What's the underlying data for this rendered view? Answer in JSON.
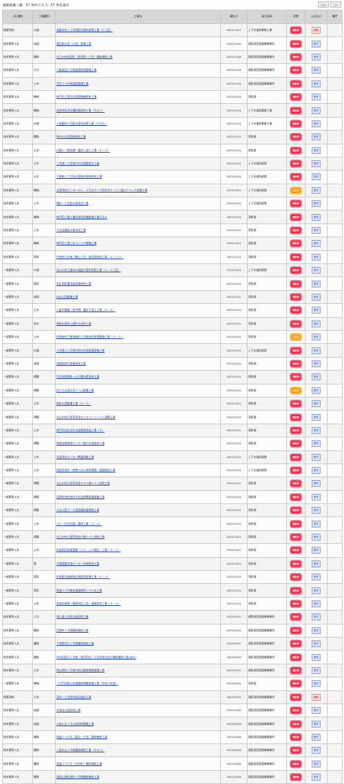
{
  "page_title": "検索結果一覧：57 件のうち 1 - 57 件を表示",
  "buttons": {
    "print": "印刷",
    "close": "出力"
  },
  "headers": [
    "入札種別",
    "工事種別",
    "工事名",
    "開札日",
    "発注部局",
    "状態",
    "入札区分",
    "備考"
  ],
  "rows": [
    {
      "type": "随意契約",
      "kind": "水道",
      "name": "長野本町三丁目他配水管布設替工事（２工区）",
      "date": "2022/11/07",
      "dept": "上下水道局事務工事",
      "status": "red",
      "status_text": "契約済",
      "badge": "red",
      "badge_text": "随契"
    },
    {
      "type": "指名競争入札",
      "kind": "造園",
      "name": "富田緑公園（公園）整備工事",
      "date": "2022/11/04",
      "dept": "建設局西部整備事務所",
      "status": "red",
      "status_text": "契約済",
      "badge": "blue",
      "badge_text": "電子"
    },
    {
      "type": "指名競争入札",
      "kind": "舗装",
      "name": "北九州市若園町（奥洞第一丁目）舗装補修工事",
      "date": "2022/11/04",
      "dept": "建設局西部整備事務所",
      "status": "red",
      "status_text": "契約済",
      "badge": "blue",
      "badge_text": "電子"
    },
    {
      "type": "指名競争入札",
      "kind": "とび",
      "name": "小敷造園２号線道路照明整備工事",
      "date": "2022/11/04",
      "dept": "建設局西部整備事務所",
      "status": "red",
      "status_text": "契約済",
      "badge": "blue",
      "badge_text": "電子"
    },
    {
      "type": "指名競争入札",
      "kind": "土木",
      "name": "浅生２５号線道路整備工事",
      "date": "2022/11/04",
      "dept": "建設局西部整備事務所",
      "status": "red",
      "status_text": "契約済",
      "badge": "blue",
      "badge_text": "電子"
    },
    {
      "type": "指名競争入札",
      "kind": "機械",
      "name": "新門司工場冷却塔電動機更新工事",
      "date": "2022/11/01",
      "dept": "契約部",
      "status": "red",
      "status_text": "契約済",
      "badge": "blue",
      "badge_text": "電子"
    },
    {
      "type": "指名競争入札",
      "kind": "機械",
      "name": "東部地区浄化槽設備改修工事（その１）",
      "date": "2022/11/01",
      "dept": "上下水道局事務工事",
      "status": "red",
      "status_text": "契約済",
      "badge": "blue",
      "badge_text": "電子"
    },
    {
      "type": "指名競争入札",
      "kind": "水道",
      "name": "上屋敷四丁目配水管布設替工事（その２）",
      "date": "2022/11/01",
      "dept": "上下水道局事務工事",
      "status": "red",
      "status_text": "契約済",
      "badge": "blue",
      "badge_text": "電子"
    },
    {
      "type": "指名競争入札",
      "kind": "舗装",
      "name": "和布刈公園園路改修工事",
      "date": "2022/11/01",
      "dept": "契約部",
      "status": "red",
      "status_text": "契約済",
      "badge": "blue",
      "badge_text": "電子"
    },
    {
      "type": "指名競争入札",
      "kind": "土木",
      "name": "白尾川（黒田橋）護岸上部工工事（４－２）",
      "date": "2022/11/01",
      "dept": "契約部",
      "status": "red",
      "status_text": "契約済",
      "badge": "blue",
      "badge_text": "電子"
    },
    {
      "type": "指名競争入札",
      "kind": "土木",
      "name": "上到津一丁目地内汚水管渠更生工事",
      "date": "2022/11/01",
      "dept": "上下水道局経理",
      "status": "red",
      "status_text": "契約済",
      "badge": "blue",
      "badge_text": "電子"
    },
    {
      "type": "指名競争入札",
      "kind": "土木",
      "name": "下曽根二丁目雨水管渠布設替改修工事",
      "date": "2022/11/01",
      "dept": "上下水道局経理",
      "status": "red",
      "status_text": "契約済",
      "badge": "blue",
      "badge_text": "電子"
    },
    {
      "type": "指名競争入札",
      "kind": "機械",
      "name": "北湊浄化センターＮｏ．４汚水ポンプ用空冷エンジン湿心クラッチ修繕工事",
      "date": "2022/11/01",
      "dept": "上下水道局経理",
      "status": "orange",
      "status_text": "入札中",
      "badge": "blue",
      "badge_text": "電子"
    },
    {
      "type": "指名競争入札",
      "kind": "土木",
      "name": "響町一丁目配水管改良工事",
      "date": "2022/11/01",
      "dept": "上下水道局経理",
      "status": "red",
      "status_text": "契約済",
      "badge": "blue",
      "badge_text": "電子"
    },
    {
      "type": "指名競争入札",
      "kind": "機械",
      "name": "新門司工場５番式焼却設備整備工事その２",
      "date": "2022/11/01",
      "dept": "契約部",
      "status": "red",
      "status_text": "契約済",
      "badge": "blue",
      "badge_text": "電子"
    },
    {
      "type": "指名競争入札",
      "kind": "土木",
      "name": "大学会館配水管布設工事",
      "date": "2022/11/01",
      "dept": "契約部",
      "status": "red",
      "status_text": "契約済",
      "badge": "blue",
      "badge_text": "電子"
    },
    {
      "type": "指名競争入札",
      "kind": "機械",
      "name": "新門司工場ごみコンベヤ整備工事",
      "date": "2022/11/01",
      "dept": "契約部",
      "status": "red",
      "status_text": "契約済",
      "badge": "blue",
      "badge_text": "電子"
    },
    {
      "type": "指名競争入札",
      "kind": "電気",
      "name": "中央町六右線（豊山工区）道号照明設工事（４－１０）",
      "date": "2022/11/01",
      "dept": "契約部",
      "status": "red",
      "status_text": "契約済",
      "badge": "blue",
      "badge_text": "電子"
    },
    {
      "type": "一般競争入札",
      "kind": "水道",
      "name": "北九州市工業用水道配水管布設替工事（４－５工区）",
      "date": "2022/11/01",
      "dept": "上下水道局経理",
      "status": "red",
      "status_text": "契約済",
      "badge": "blue",
      "badge_text": "電子"
    },
    {
      "type": "一般競争入札",
      "kind": "電気",
      "name": "若松消防署改造設備改修工事",
      "date": "2022/11/01",
      "dept": "契約部",
      "status": "red",
      "status_text": "契約済",
      "badge": "blue",
      "badge_text": "電子"
    },
    {
      "type": "一般競争入札",
      "kind": "造園",
      "name": "仙水公園整備工事",
      "date": "2022/11/01",
      "dept": "契約部",
      "status": "red",
      "status_text": "契約済",
      "badge": "blue",
      "badge_text": "電子"
    },
    {
      "type": "一般競争入札",
      "kind": "土木",
      "name": "小倉中間線（徳代橋）護岸下部工工事（４－１）",
      "date": "2022/11/01",
      "dept": "契約部",
      "status": "red",
      "status_text": "契約済",
      "badge": "blue",
      "badge_text": "電子"
    },
    {
      "type": "一般競争入札",
      "kind": "防水",
      "name": "曽根出張所上層防水改修工事",
      "date": "2022/11/01",
      "dept": "契約部",
      "status": "red",
      "status_text": "契約済",
      "badge": "blue",
      "badge_text": "電子"
    },
    {
      "type": "一般競争入札",
      "kind": "土木",
      "name": "田原新町下曽根新町１号線自転車通整備工事（４－２）",
      "date": "2022/11/01",
      "dept": "契約部",
      "status": "orange",
      "status_text": "入札中",
      "badge": "blue",
      "badge_text": "電子"
    },
    {
      "type": "一般競争入札",
      "kind": "水道",
      "name": "上到津二丁目地内雨水合流管渠整備工事",
      "date": "2022/11/01",
      "dept": "上下水道局経理",
      "status": "red",
      "status_text": "契約済",
      "badge": "blue",
      "badge_text": "電子"
    },
    {
      "type": "一般競争入札",
      "kind": "塗装",
      "name": "道路照明灯整備塗装工事",
      "date": "2022/11/01",
      "dept": "契約部",
      "status": "red",
      "status_text": "契約済",
      "badge": "blue",
      "badge_text": "電子"
    },
    {
      "type": "一般競争入札",
      "kind": "建築",
      "name": "門司消防署和ー丈分署外壁改修工事",
      "date": "2022/11/01",
      "dept": "契約部",
      "status": "red",
      "status_text": "契約済",
      "badge": "blue",
      "badge_text": "電子"
    },
    {
      "type": "一般競争入札",
      "kind": "建築",
      "name": "松ケ江公園天空ドーム整備工事",
      "date": "2022/11/01",
      "dept": "契約部",
      "status": "orange",
      "status_text": "入札中",
      "badge": "blue",
      "badge_text": "電子"
    },
    {
      "type": "一般競争入札",
      "kind": "土木",
      "name": "新町公園整備工事（４－１）",
      "date": "2022/11/01",
      "dept": "契約部",
      "status": "red",
      "status_text": "契約済",
      "badge": "blue",
      "badge_text": "電子"
    },
    {
      "type": "一般競争入札",
      "kind": "建築",
      "name": "北九州市立高等学校テニスコートトイレ改築工事",
      "date": "2022/11/01",
      "dept": "契約部",
      "status": "red",
      "status_text": "契約済",
      "badge": "blue",
      "badge_text": "電子"
    },
    {
      "type": "一般競争入札",
      "kind": "土木",
      "name": "新門司北住宅北水道管路改造工事（４）",
      "date": "2022/11/01",
      "dept": "契約部",
      "status": "red",
      "status_text": "契約済",
      "badge": "blue",
      "badge_text": "電子"
    },
    {
      "type": "一般競争入札",
      "kind": "建築",
      "name": "情報技術教育センター露の空調改修工事",
      "date": "2022/11/01",
      "dept": "契約部",
      "status": "red",
      "status_text": "契約済",
      "badge": "blue",
      "badge_text": "電子"
    },
    {
      "type": "一般競争入札",
      "kind": "土木",
      "name": "北湊浄化センター覆蓋改築工事",
      "date": "2022/11/01",
      "dept": "上下水道局経理",
      "status": "red",
      "status_text": "契約済",
      "badge": "blue",
      "badge_text": "電子"
    },
    {
      "type": "一般競争入札",
      "kind": "土木",
      "name": "相見町地内（南勲川河川改修関連）管渠移設工事",
      "date": "2022/11/01",
      "dept": "上下水道局経理",
      "status": "red",
      "status_text": "契約済",
      "badge": "blue",
      "badge_text": "電子"
    },
    {
      "type": "一般競争入札",
      "kind": "建築",
      "name": "北九州市立高等学校ＲＧＨ棟トイレ改修工事",
      "date": "2022/11/01",
      "dept": "契約部",
      "status": "red",
      "status_text": "契約済",
      "badge": "blue",
      "badge_text": "電子"
    },
    {
      "type": "一般競争入札",
      "kind": "建築",
      "name": "葛原町地内他雨水合流改築管渠整備工事",
      "date": "2022/11/01",
      "dept": "契約部",
      "status": "red",
      "status_text": "契約済",
      "badge": "blue",
      "badge_text": "電子"
    },
    {
      "type": "一般競争入札",
      "kind": "建築",
      "name": "大谷公園プール管理棟耐震補強工事",
      "date": "2022/11/01",
      "dept": "契約部",
      "status": "red",
      "status_text": "契約済",
      "badge": "blue",
      "badge_text": "電子"
    },
    {
      "type": "一般競争入札",
      "kind": "土木",
      "name": "江川（住宅区間）護岸工事（４－４）",
      "date": "2022/11/01",
      "dept": "契約部",
      "status": "red",
      "status_text": "契約済",
      "badge": "blue",
      "badge_text": "電子"
    },
    {
      "type": "一般競争入札",
      "kind": "建築",
      "name": "北九州市立高等学校Ｄ棟トイレ改修工事",
      "date": "2022/11/01",
      "dept": "契約部",
      "status": "red",
      "status_text": "契約済",
      "badge": "blue",
      "badge_text": "電子"
    },
    {
      "type": "一般競争入札",
      "kind": "土木",
      "name": "折尾地区街路整備（２３，２４前区）工事（４－３）",
      "date": "2022/11/01",
      "dept": "契約部",
      "status": "red",
      "status_text": "契約済",
      "badge": "blue",
      "badge_text": "電子"
    },
    {
      "type": "一般競争入札",
      "kind": "管",
      "name": "水環境館交流センター空調改修工事",
      "date": "2022/11/01",
      "dept": "契約部",
      "status": "red",
      "status_text": "契約済",
      "badge": "blue",
      "badge_text": "電子"
    },
    {
      "type": "一般競争入札",
      "kind": "電気",
      "name": "折尾駅北側駅前広場照明設備工事（４－２）",
      "date": "2022/11/01",
      "dept": "契約部",
      "status": "red",
      "status_text": "契約済",
      "badge": "blue",
      "badge_text": "電子"
    },
    {
      "type": "一般競争入札",
      "kind": "電気",
      "name": "国道４６号線他道路照明ＬＥＤ化工事",
      "date": "2022/11/01",
      "dept": "契約部",
      "status": "red",
      "status_text": "契約済",
      "badge": "blue",
      "badge_text": "電子"
    },
    {
      "type": "一般競争入札",
      "kind": "土木",
      "name": "尾倉町線線（東尾街区工区）道路改良工事（４－３）",
      "date": "2022/11/01",
      "dept": "契約部",
      "status": "red",
      "status_text": "契約済",
      "badge": "blue",
      "badge_text": "電子"
    },
    {
      "type": "指名競争入札",
      "kind": "とび",
      "name": "南小倉小学校法面改修工事",
      "date": "2022/10/31",
      "dept": "建設局西部整備事務所",
      "status": "red",
      "status_text": "契約済",
      "badge": "blue",
      "badge_text": "電子"
    },
    {
      "type": "指名競争入札",
      "kind": "舗装",
      "name": "西港町１号線舗装補修工事",
      "date": "2022/10/31",
      "dept": "建設局西部整備事務所",
      "status": "red",
      "status_text": "契約済",
      "badge": "blue",
      "badge_text": "電子"
    },
    {
      "type": "指名競争入札",
      "kind": "舗装",
      "name": "下城野北方１号線舗装補修工事",
      "date": "2022/10/31",
      "dept": "建設局西部整備事務所",
      "status": "red",
      "status_text": "契約済",
      "badge": "blue",
      "badge_text": "電子"
    },
    {
      "type": "指名競争入札",
      "kind": "舗装",
      "name": "市内回伊川１号線・新門司北一丁目交差点ほか舗装補修工事(ほか)",
      "date": "2022/10/31",
      "dept": "建設局西部整備事務所",
      "status": "red",
      "status_text": "契約済",
      "badge": "blue",
      "badge_text": "電子"
    },
    {
      "type": "指名競争入札",
      "kind": "土木",
      "name": "熊谷原町１号線中央分離帯景観整備工事",
      "date": "2022/10/31",
      "dept": "建設局西部整備事務所",
      "status": "red",
      "status_text": "契約済",
      "badge": "blue",
      "badge_text": "電子"
    },
    {
      "type": "一般競争入札",
      "kind": "機械",
      "name": "ＪＲ門司駅公共通路昇降機修繕工事（令和４年度）",
      "date": "2022/10/31",
      "dept": "契約部",
      "status": "red",
      "status_text": "契約済",
      "badge": "blue",
      "badge_text": "電子"
    },
    {
      "type": "随意契約",
      "kind": "土木",
      "name": "清水一丁目地内陥没復旧工事",
      "date": "2022/10/31",
      "dept": "建設局西部整備事務所",
      "status": "red",
      "status_text": "契約済",
      "badge": "red",
      "badge_text": "随契"
    },
    {
      "type": "指名競争入札",
      "kind": "造園",
      "name": "本城北公園改修工事",
      "date": "2022/10/28",
      "dept": "建設局西部整備事務所",
      "status": "red",
      "status_text": "契約済",
      "badge": "blue",
      "badge_text": "電子"
    },
    {
      "type": "指名競争入札",
      "kind": "造園",
      "name": "久岐川水１号公園改修整備工事",
      "date": "2022/10/28",
      "dept": "建設局西部整備事務所",
      "status": "red",
      "status_text": "契約済",
      "badge": "blue",
      "badge_text": "電子"
    },
    {
      "type": "指名競争入札",
      "kind": "舗装",
      "name": "国道１９９号（富丸一丁目）舗装補修工事",
      "date": "2022/10/28",
      "dept": "建設局西部整備事務所",
      "status": "red",
      "status_text": "契約済",
      "badge": "blue",
      "badge_text": "電子"
    },
    {
      "type": "指名競争入札",
      "kind": "舗装",
      "name": "二島木山１号線舗装補修工事（その１）",
      "date": "2022/10/28",
      "dept": "建設局西部整備事務所",
      "status": "red",
      "status_text": "契約済",
      "badge": "blue",
      "badge_text": "電子"
    },
    {
      "type": "指名競争入札",
      "kind": "舗装",
      "name": "国道４９５号（白沖町）舗装補修工事",
      "date": "2022/10/28",
      "dept": "建設局西部整備事務所",
      "status": "red",
      "status_text": "契約済",
      "badge": "blue",
      "badge_text": "電子"
    },
    {
      "type": "指名競争入札",
      "kind": "舗装",
      "name": "清田山頭松尾町１号線舗装補修工事",
      "date": "2022/10/28",
      "dept": "建設局西部整備事務所",
      "status": "red",
      "status_text": "契約済",
      "badge": "blue",
      "badge_text": "電子"
    }
  ]
}
